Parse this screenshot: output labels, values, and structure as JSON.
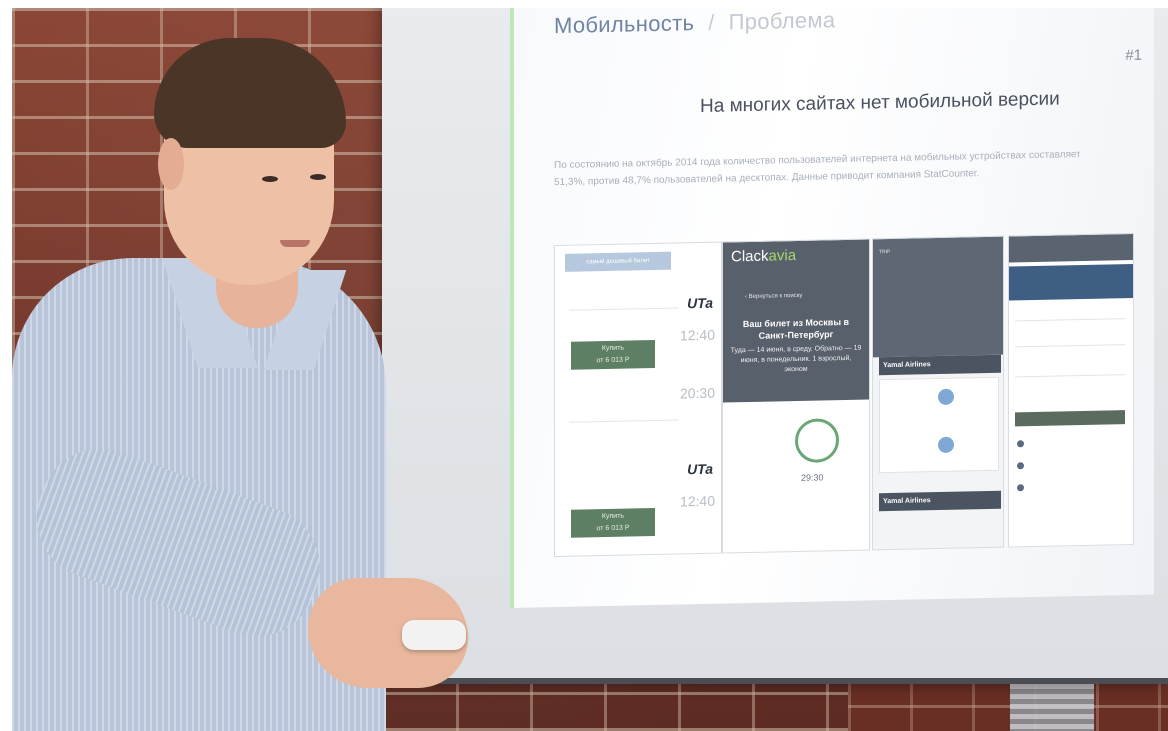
{
  "slide": {
    "heading": "Мобильность",
    "separator": "/",
    "subheading": "Проблема",
    "number": "#1",
    "title": "На многих сайтах нет мобильной версии",
    "body": "По состоянию на октябрь 2014 года количество пользователей интернета на мобильных устройствах составляет 51,3%, против 48,7% пользователей на десктопах. Данные приводит компания StatCounter."
  },
  "thumbnails": {
    "t1": {
      "pill": "самый дешевый билет",
      "buy_1": "Купить",
      "buy_1_price": "от 6 013 Р",
      "buy_2": "Купить",
      "buy_2_price": "от 6 013 Р",
      "airline_1": "UTa",
      "airline_2": "UTa",
      "time_1": "12:40",
      "time_2": "20:30",
      "time_3": "12:40"
    },
    "t2": {
      "logo_prefix": "Clack",
      "logo_brand": "avia",
      "back": "‹ Вернуться к поиску",
      "ticket_title": "Ваш билет из Москвы в Санкт-Петербург",
      "ticket_info": "Туда — 14 июня, в среду. Обратно — 19 июня, в понедельник. 1 взрослый, эконом",
      "count": "29:30"
    },
    "t3": {
      "nav": "TRIP",
      "card_title": "Yamal Airlines",
      "footer_title": "Yamal Airlines"
    }
  },
  "colors": {
    "brick": "#7d3b2d",
    "slide_heading": "#6f85a3",
    "buy_button": "#5d7f63",
    "clackavia_brand": "#a5d86a"
  }
}
